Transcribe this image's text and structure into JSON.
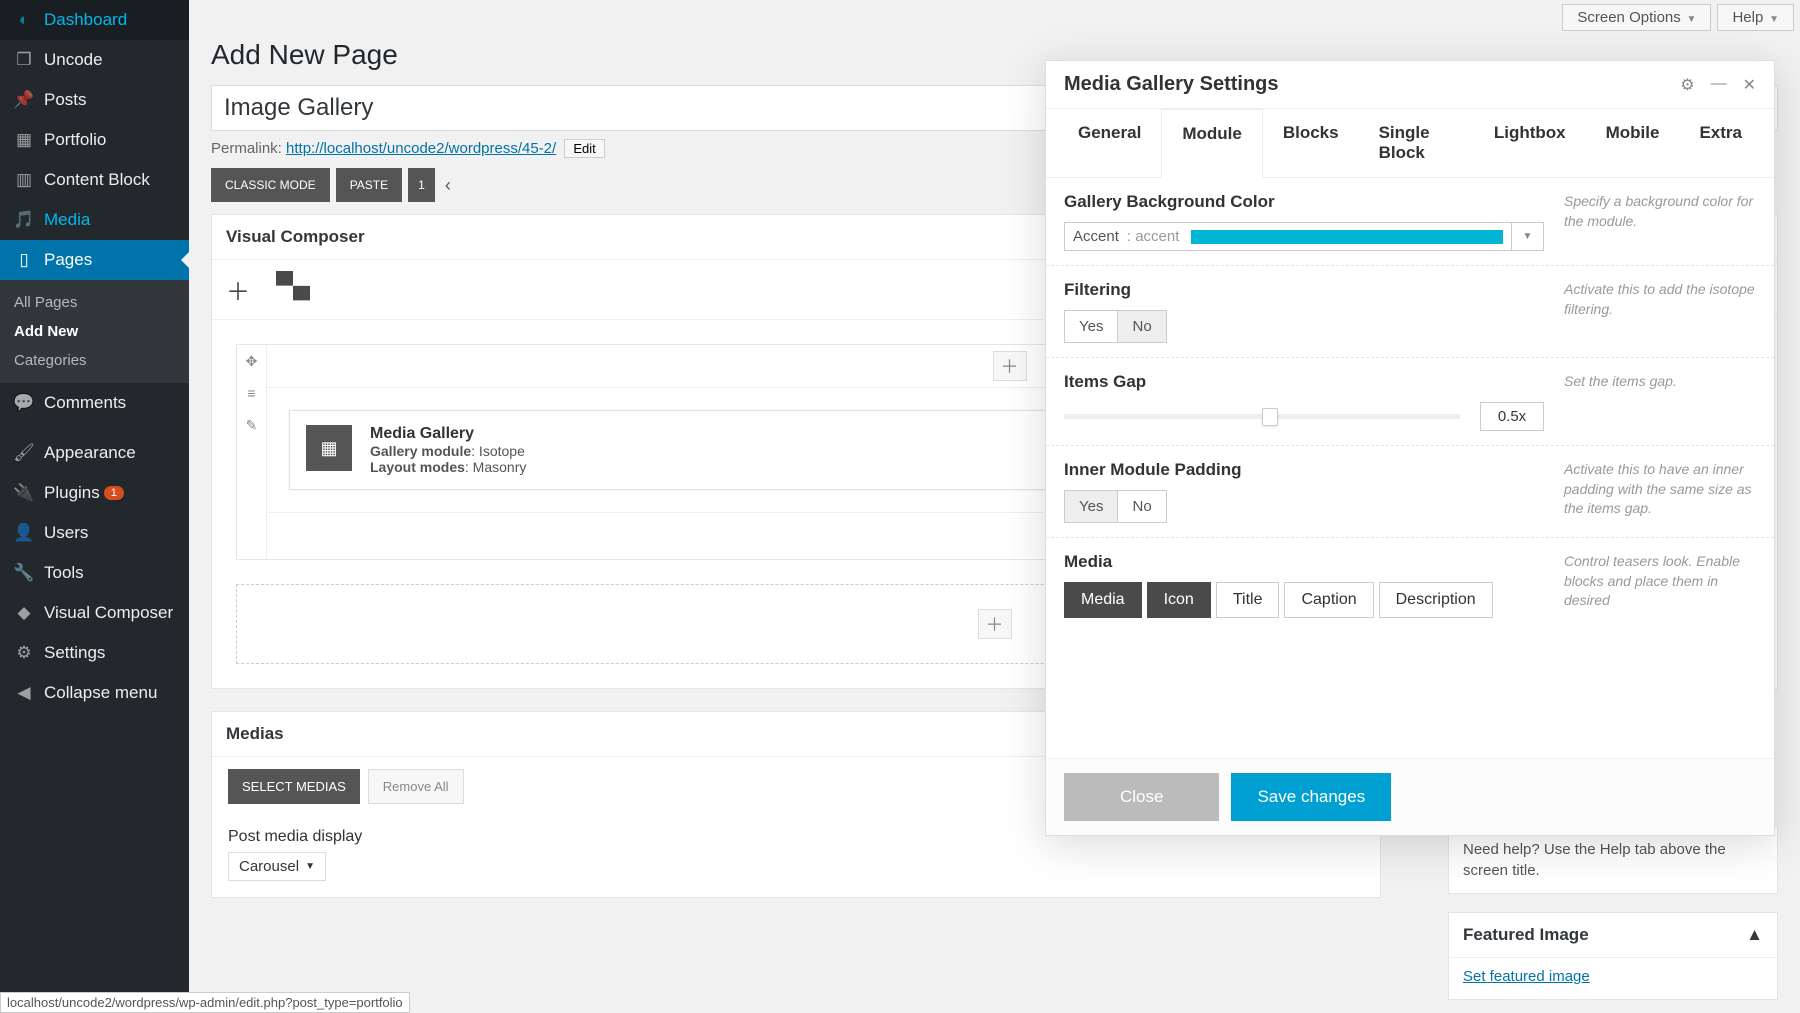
{
  "sidebar": {
    "items": [
      {
        "label": "Dashboard"
      },
      {
        "label": "Uncode"
      },
      {
        "label": "Posts"
      },
      {
        "label": "Portfolio"
      },
      {
        "label": "Content Block"
      },
      {
        "label": "Media"
      },
      {
        "label": "Pages"
      },
      {
        "label": "Comments"
      },
      {
        "label": "Appearance"
      },
      {
        "label": "Plugins",
        "badge": "1"
      },
      {
        "label": "Users"
      },
      {
        "label": "Tools"
      },
      {
        "label": "Visual Composer"
      },
      {
        "label": "Settings"
      },
      {
        "label": "Collapse menu"
      }
    ],
    "sub": {
      "items": [
        {
          "label": "All Pages"
        },
        {
          "label": "Add New"
        },
        {
          "label": "Categories"
        }
      ]
    }
  },
  "topbar": {
    "screenOptions": "Screen Options",
    "help": "Help"
  },
  "page": {
    "title": "Add New Page",
    "titleInput": "Image Gallery",
    "permalinkLabel": "Permalink:",
    "permalinkUrl": "http://localhost/uncode2/wordpress/45-2/",
    "editBtn": "Edit"
  },
  "toolbar": {
    "classic": "CLASSIC MODE",
    "paste": "PASTE",
    "one": "1"
  },
  "vc": {
    "header": "Visual Composer",
    "block": {
      "title": "Media Gallery",
      "l1k": "Gallery module",
      "l1v": ": Isotope",
      "l2k": "Layout modes",
      "l2v": ": Masonry"
    }
  },
  "medias": {
    "header": "Medias",
    "select": "SELECT MEDIAS",
    "remove": "Remove All",
    "postLabel": "Post media display",
    "postValue": "Carousel"
  },
  "modal": {
    "title": "Media Gallery Settings",
    "tabs": [
      "General",
      "Module",
      "Blocks",
      "Single Block",
      "Lightbox",
      "Mobile",
      "Extra"
    ],
    "bgColor": {
      "label": "Gallery Background Color",
      "name": "Accent",
      "sub": ": accent",
      "help": "Specify a background color for the module.",
      "accentHex": "#00b6d4"
    },
    "filtering": {
      "label": "Filtering",
      "yes": "Yes",
      "no": "No",
      "help": "Activate this to add the isotope filtering."
    },
    "gap": {
      "label": "Items Gap",
      "value": "0.5x",
      "help": "Set the items gap."
    },
    "padding": {
      "label": "Inner Module Padding",
      "yes": "Yes",
      "no": "No",
      "help": "Activate this to have an inner padding with the same size as the items gap."
    },
    "media": {
      "label": "Media",
      "btns": [
        "Media",
        "Icon",
        "Title",
        "Caption",
        "Description"
      ],
      "help": "Control teasers look. Enable blocks and place them in desired"
    },
    "close": "Close",
    "save": "Save changes"
  },
  "right": {
    "helpHint": "Need help? Use the Help tab above the screen title.",
    "featured": "Featured Image",
    "setFeatured": "Set featured image"
  },
  "status": "localhost/uncode2/wordpress/wp-admin/edit.php?post_type=portfolio"
}
